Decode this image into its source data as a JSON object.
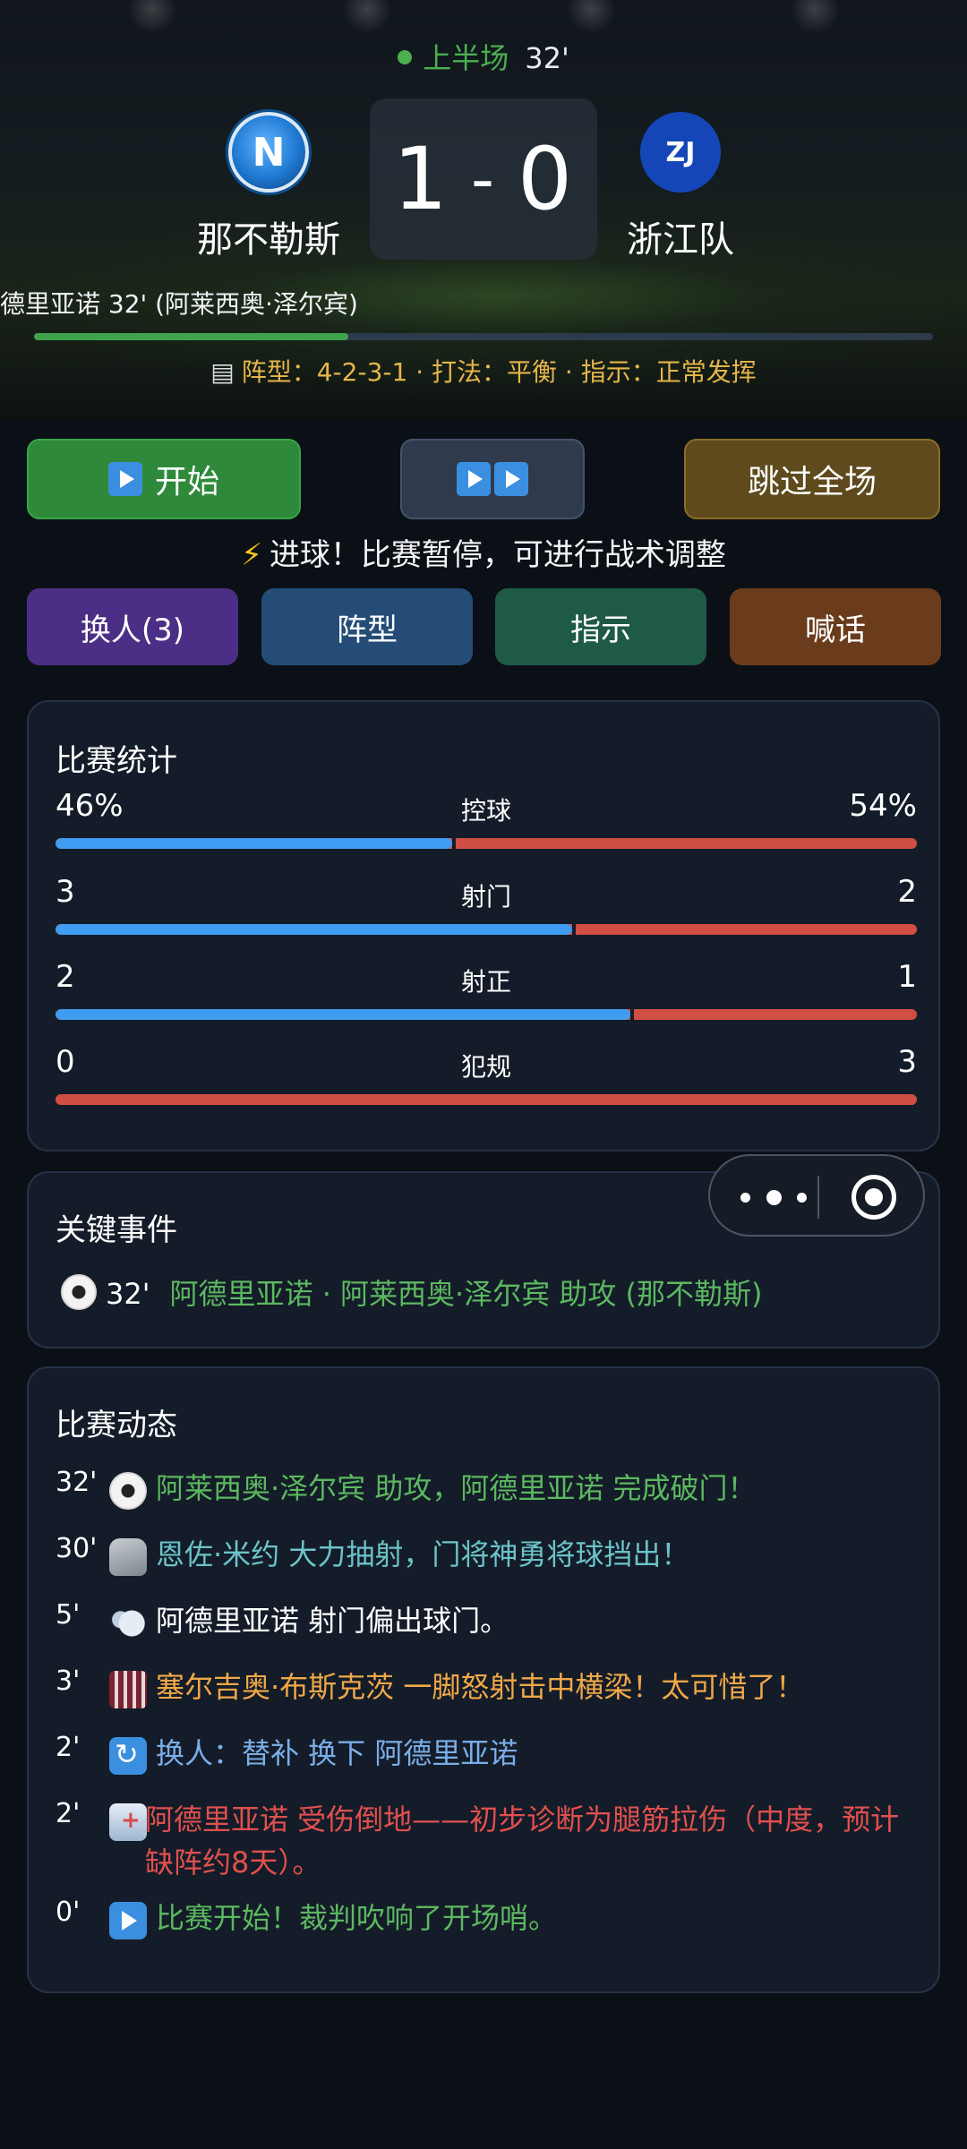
{
  "match": {
    "half": "上半场",
    "minute": "32'",
    "home": {
      "name": "那不勒斯",
      "crest": "N"
    },
    "away": {
      "name": "浙江队",
      "crest": "ZJ"
    },
    "score_home": "1",
    "score_away": "0",
    "score_sep": "-",
    "scorer_line": "德里亚诺 32' (阿莱西奥·泽尔宾)",
    "progress_fraction": 0.35,
    "tactics": "阵型：4-2-3-1 · 打法：平衡 · 指示：正常发挥"
  },
  "controls": {
    "start_label": "开始",
    "skip_label": "跳过全场",
    "pause_note": "进球！比赛暂停，可进行战术调整",
    "subs_label": "换人(3)",
    "formation_label": "阵型",
    "instructions_label": "指示",
    "shout_label": "喊话"
  },
  "stats": {
    "title": "比赛统计",
    "rows": [
      {
        "label": "控球",
        "home": "46%",
        "away": "54%",
        "home_share": 0.46
      },
      {
        "label": "射门",
        "home": "3",
        "away": "2",
        "home_share": 0.6
      },
      {
        "label": "射正",
        "home": "2",
        "away": "1",
        "home_share": 0.667
      },
      {
        "label": "犯规",
        "home": "0",
        "away": "3",
        "home_share": 0.0
      }
    ]
  },
  "key_events": {
    "title": "关键事件",
    "items": [
      {
        "minute": "32'",
        "icon": "soccer-ball-icon",
        "text": "阿德里亚诺 · 阿莱西奥·泽尔宾 助攻 (那不勒斯)"
      }
    ]
  },
  "feed": {
    "title": "比赛动态",
    "items": [
      {
        "minute": "32'",
        "icon": "soccer-ball-icon",
        "text": "阿莱西奥·泽尔宾 助攻，阿德里亚诺 完成破门！",
        "color": "#5cb860"
      },
      {
        "minute": "30'",
        "icon": "goalkeeper-glove-icon",
        "text": "恩佐·米约 大力抽射，门将神勇将球挡出！",
        "color": "#6cc3c9"
      },
      {
        "minute": "5'",
        "icon": "dash-wind-icon",
        "text": "阿德里亚诺 射门偏出球门。",
        "color": "#ffffff"
      },
      {
        "minute": "3'",
        "icon": "stadium-icon",
        "text": "塞尔吉奥·布斯克茨 一脚怒射击中横梁！太可惜了！",
        "color": "#f0a848"
      },
      {
        "minute": "2'",
        "icon": "substitution-icon",
        "text": "换人：替补 换下 阿德里亚诺",
        "color": "#7aaee8"
      },
      {
        "minute": "2'",
        "icon": "hospital-icon",
        "text": "阿德里亚诺 受伤倒地——初步诊断为腿筋拉伤（中度，预计缺阵约8天）。",
        "color": "#e0504e"
      },
      {
        "minute": "0'",
        "icon": "play-icon",
        "text": "比赛开始！裁判吹响了开场哨。",
        "color": "#5cb860"
      }
    ]
  },
  "colors": {
    "home_bar": "#3f9cf0",
    "away_bar": "#d04e44",
    "accent_green": "#4caf50",
    "tactic_gold": "#e6b64a"
  }
}
